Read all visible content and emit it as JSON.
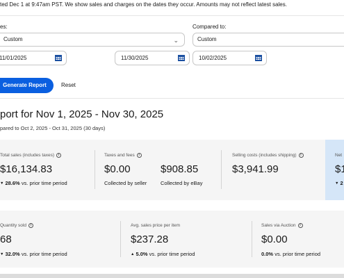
{
  "note": "ted Dec 1 at 9:47am PST. We show sales and charges on the dates they occur. Amounts may not reflect latest sales.",
  "filters": {
    "period_label": "es:",
    "period_value": "Custom",
    "compare_label": "Compared to:",
    "compare_value": "Custom",
    "start_date": "11/01/2025",
    "end_date": "11/30/2025",
    "compare_start_date": "10/02/2025"
  },
  "actions": {
    "generate_label": "Generate Report",
    "reset_label": "Reset"
  },
  "report": {
    "title": "port for Nov 1, 2025 - Nov 30, 2025",
    "subtitle": "pared to Oct 2, 2025 - Oct 31, 2025 (30 days)"
  },
  "metrics_row1": {
    "total_sales": {
      "label": "Total sales (includes taxes)",
      "value": "$16,134.83",
      "change": "28.6%",
      "change_text": "vs. prior time period",
      "direction": "down"
    },
    "taxes_fees": {
      "label": "Taxes and fees",
      "value_seller": "$0.00",
      "value_ebay": "$908.85",
      "seller_caption": "Collected by seller",
      "ebay_caption": "Collected by eBay"
    },
    "selling_costs": {
      "label": "Selling costs (includes shipping)",
      "value": "$3,941.99"
    },
    "net": {
      "label": "Net",
      "value": "$1",
      "change": "2"
    }
  },
  "metrics_row2": {
    "quantity_sold": {
      "label": "Quantity sold",
      "value": "68",
      "change": "32.0%",
      "change_text": "vs. prior time period",
      "direction": "down"
    },
    "avg_price": {
      "label": "Avg. sales price per item",
      "value": "$237.28",
      "change": "5.0%",
      "change_text": "vs. prior time period",
      "direction": "up"
    },
    "auction_sales": {
      "label": "Sales via Auction",
      "value": "$0.00",
      "change": "0.0%",
      "change_text": "vs. prior time period"
    }
  },
  "icons": {
    "info": "i",
    "chevron": "⌄",
    "arrow_down": "▼",
    "arrow_up": "▲"
  },
  "colors": {
    "accent": "#0a5fe0",
    "card_bg": "#f5f5f5",
    "highlight_bg": "#d5e6f8",
    "calendar_icon": "#1a4fa0"
  }
}
